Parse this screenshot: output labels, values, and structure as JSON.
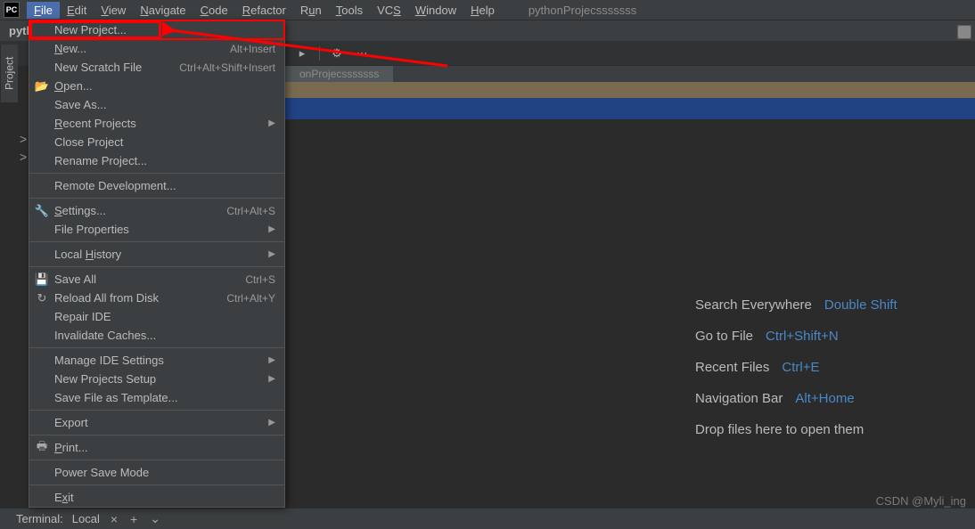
{
  "menubar": {
    "items": [
      {
        "label": "File",
        "mnemonic": "F"
      },
      {
        "label": "Edit",
        "mnemonic": "E"
      },
      {
        "label": "View",
        "mnemonic": "V"
      },
      {
        "label": "Navigate",
        "mnemonic": "N"
      },
      {
        "label": "Code",
        "mnemonic": "C"
      },
      {
        "label": "Refactor",
        "mnemonic": "R"
      },
      {
        "label": "Run",
        "mnemonic": "u"
      },
      {
        "label": "Tools",
        "mnemonic": "T"
      },
      {
        "label": "VCS",
        "mnemonic": "S"
      },
      {
        "label": "Window",
        "mnemonic": "W"
      },
      {
        "label": "Help",
        "mnemonic": "H"
      }
    ],
    "project_name": "pythonProjecsssssss",
    "app_icon_text": "PC"
  },
  "navbar": {
    "project_label": "pyth"
  },
  "file_menu": {
    "groups": [
      [
        {
          "label": "New Project...",
          "icon": "",
          "shortcut": "",
          "submenu": false,
          "highlight": true
        },
        {
          "label": "New...",
          "icon": "",
          "shortcut": "Alt+Insert",
          "submenu": false,
          "mnemonic": "N"
        },
        {
          "label": "New Scratch File",
          "icon": "",
          "shortcut": "Ctrl+Alt+Shift+Insert",
          "submenu": false
        },
        {
          "label": "Open...",
          "icon": "folder-open-icon",
          "shortcut": "",
          "submenu": false,
          "mnemonic": "O"
        },
        {
          "label": "Save As...",
          "icon": "",
          "shortcut": "",
          "submenu": false
        },
        {
          "label": "Recent Projects",
          "icon": "",
          "shortcut": "",
          "submenu": true,
          "mnemonic": "R"
        },
        {
          "label": "Close Project",
          "icon": "",
          "shortcut": "",
          "submenu": false
        },
        {
          "label": "Rename Project...",
          "icon": "",
          "shortcut": "",
          "submenu": false
        }
      ],
      [
        {
          "label": "Remote Development...",
          "icon": "",
          "shortcut": "",
          "submenu": false
        }
      ],
      [
        {
          "label": "Settings...",
          "icon": "wrench-icon",
          "shortcut": "Ctrl+Alt+S",
          "submenu": false,
          "mnemonic": "S"
        },
        {
          "label": "File Properties",
          "icon": "",
          "shortcut": "",
          "submenu": true
        }
      ],
      [
        {
          "label": "Local History",
          "icon": "",
          "shortcut": "",
          "submenu": true,
          "mnemonic": "H"
        }
      ],
      [
        {
          "label": "Save All",
          "icon": "save-icon",
          "shortcut": "Ctrl+S",
          "submenu": false
        },
        {
          "label": "Reload All from Disk",
          "icon": "reload-icon",
          "shortcut": "Ctrl+Alt+Y",
          "submenu": false
        },
        {
          "label": "Repair IDE",
          "icon": "",
          "shortcut": "",
          "submenu": false
        },
        {
          "label": "Invalidate Caches...",
          "icon": "",
          "shortcut": "",
          "submenu": false
        }
      ],
      [
        {
          "label": "Manage IDE Settings",
          "icon": "",
          "shortcut": "",
          "submenu": true
        },
        {
          "label": "New Projects Setup",
          "icon": "",
          "shortcut": "",
          "submenu": true
        },
        {
          "label": "Save File as Template...",
          "icon": "",
          "shortcut": "",
          "submenu": false
        }
      ],
      [
        {
          "label": "Export",
          "icon": "",
          "shortcut": "",
          "submenu": true
        }
      ],
      [
        {
          "label": "Print...",
          "icon": "print-icon",
          "shortcut": "",
          "submenu": false,
          "mnemonic": "P"
        }
      ],
      [
        {
          "label": "Power Save Mode",
          "icon": "",
          "shortcut": "",
          "submenu": false
        }
      ],
      [
        {
          "label": "Exit",
          "icon": "",
          "shortcut": "",
          "submenu": false,
          "mnemonic": "x"
        }
      ]
    ]
  },
  "sidebar": {
    "tab_label": "Project",
    "collapse_markers": [
      ">",
      ">"
    ]
  },
  "editor_tab": {
    "label": "onProjecsssssss"
  },
  "welcome": {
    "rows": [
      {
        "label": "Search Everywhere",
        "shortcut": "Double Shift"
      },
      {
        "label": "Go to File",
        "shortcut": "Ctrl+Shift+N"
      },
      {
        "label": "Recent Files",
        "shortcut": "Ctrl+E"
      },
      {
        "label": "Navigation Bar",
        "shortcut": "Alt+Home"
      }
    ],
    "drop_hint": "Drop files here to open them"
  },
  "bottombar": {
    "terminal_label": "Terminal:",
    "session_label": "Local"
  },
  "watermark": "CSDN @Myli_ing",
  "icons": {
    "folder-open-icon": "📂",
    "wrench-icon": "🔧",
    "save-icon": "💾",
    "reload-icon": "↻",
    "print-icon": "🖶",
    "gear-icon": "⚙",
    "plus-icon": "+",
    "chevron-down-icon": "⌄",
    "close-icon": "×",
    "hammer-icon": "▸"
  }
}
